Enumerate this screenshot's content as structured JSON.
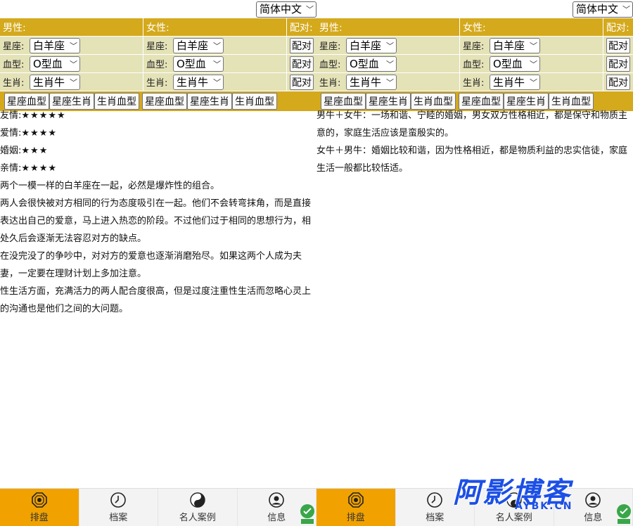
{
  "language": "简体中文",
  "header": {
    "male": "男性:",
    "female": "女性:",
    "pair": "配对:"
  },
  "labels": {
    "sign": "星座:",
    "blood": "血型:",
    "zodiac": "生肖:"
  },
  "selects": {
    "sign": "白羊座",
    "blood": "O型血",
    "zodiac": "生肖牛"
  },
  "pair_button": "配对",
  "tabs": [
    "星座血型",
    "星座生肖",
    "生肖血型"
  ],
  "left": {
    "ratings": [
      {
        "label": "友情:",
        "stars": "★★★★★"
      },
      {
        "label": "爱情:",
        "stars": "★★★★"
      },
      {
        "label": "婚姻:",
        "stars": "★★★"
      },
      {
        "label": "亲情:",
        "stars": "★★★★"
      }
    ],
    "paragraphs": [
      "两个一模一样的白羊座在一起，必然是爆炸性的组合。",
      "两人会很快被对方相同的行为态度吸引在一起。他们不会转弯抹角，而是直接表达出自己的爱意，马上进入热恋的阶段。不过他们过于相同的思想行为，相处久后会逐渐无法容忍对方的缺点。",
      "在没完没了的争吵中，对对方的爱意也逐渐消磨殆尽。如果这两个人成为夫妻，一定要在理财计划上多加注意。",
      "性生活方面，充满活力的两人配合度很高，但是过度注重性生活而忽略心灵上的沟通也是他们之间的大问题。"
    ]
  },
  "right": {
    "paragraphs": [
      "男牛＋女牛：一场和谐、宁睦的婚姻，男女双方性格相近，都是保守和物质主意的，家庭生活应该是蛮殷实的。",
      "女牛＋男牛：婚姻比较和谐，因为性格相近，都是物质利益的忠实信徒，家庭生活一般都比较恬适。"
    ]
  },
  "nav": [
    "排盘",
    "档案",
    "名人案例",
    "信息"
  ],
  "watermark": {
    "big": "阿影博客",
    "small": "AYBK.CN"
  },
  "colors": {
    "gold": "#d4a91c",
    "beige": "#e4e2b7",
    "nav_active": "#f1a200",
    "watermark": "#1c4fe6"
  }
}
